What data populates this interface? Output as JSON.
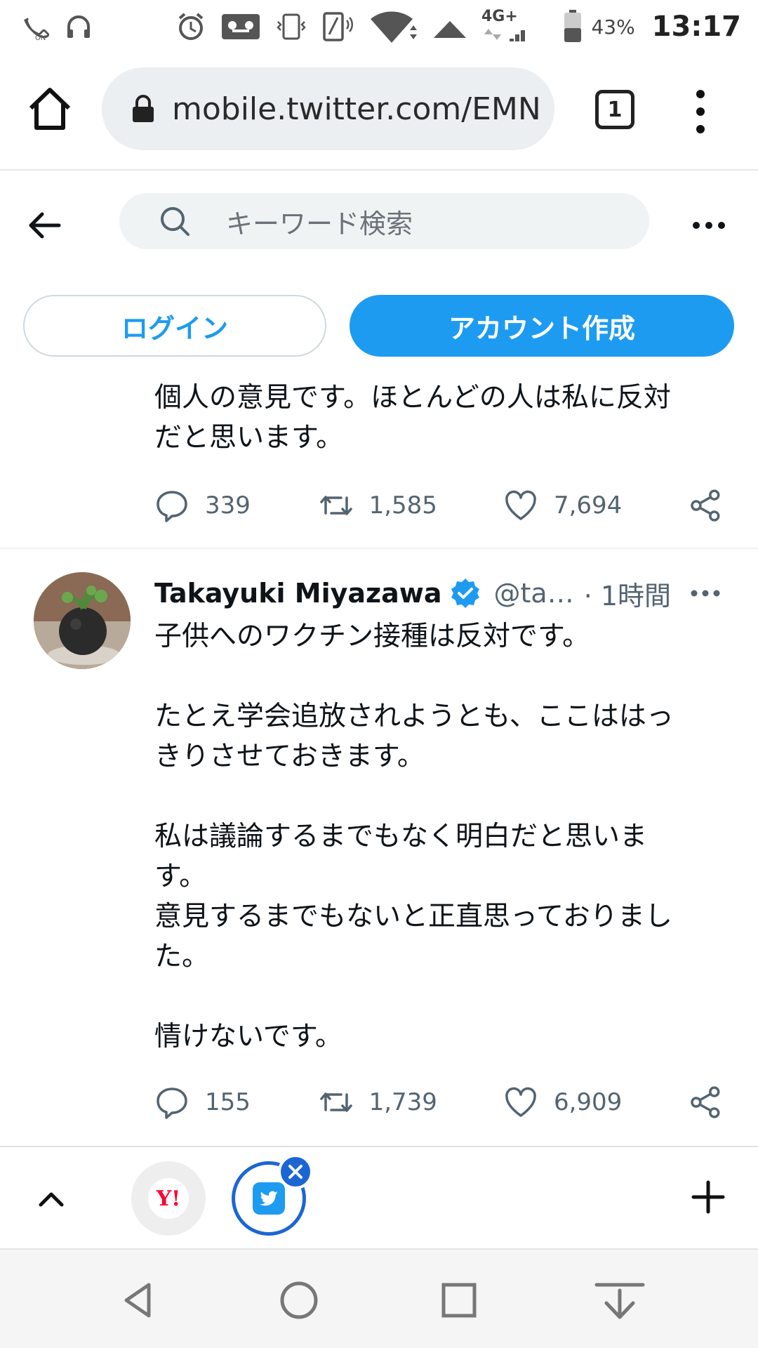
{
  "status_bar": {
    "battery_percent": "43%",
    "network": "4G+",
    "time": "13:17",
    "icons": [
      "call-volte-icon",
      "headphones-icon",
      "alarm-icon",
      "voicemail-icon",
      "vibrate-icon",
      "nfc-icon",
      "wifi-icon",
      "signal-icon",
      "battery-icon"
    ]
  },
  "browser": {
    "url": "mobile.twitter.com/EMN",
    "tab_count": "1"
  },
  "twitter": {
    "search_placeholder": "キーワード検索",
    "login_label": "ログイン",
    "signup_label": "アカウント作成",
    "accent_color": "#1d9bf0"
  },
  "tweets": [
    {
      "text": "個人の意見です。ほとんどの人は私に反対\nだと思います。",
      "replies": "339",
      "retweets": "1,585",
      "likes": "7,694"
    },
    {
      "author_name": "Takayuki Miyazawa",
      "handle": "@ta…",
      "time": "· 1時間",
      "verified": true,
      "text": "子供へのワクチン接種は反対です。\n\nたとえ学会追放されようとも、ここははっ\nきりさせておきます。\n\n私は議論するまでもなく明白だと思いま\nす。\n意見するまでもないと正直思っておりまし\nた。\n\n情けないです。",
      "replies": "155",
      "retweets": "1,739",
      "likes": "6,909"
    }
  ],
  "tab_bar": {
    "yahoo_logo": "Y!"
  }
}
